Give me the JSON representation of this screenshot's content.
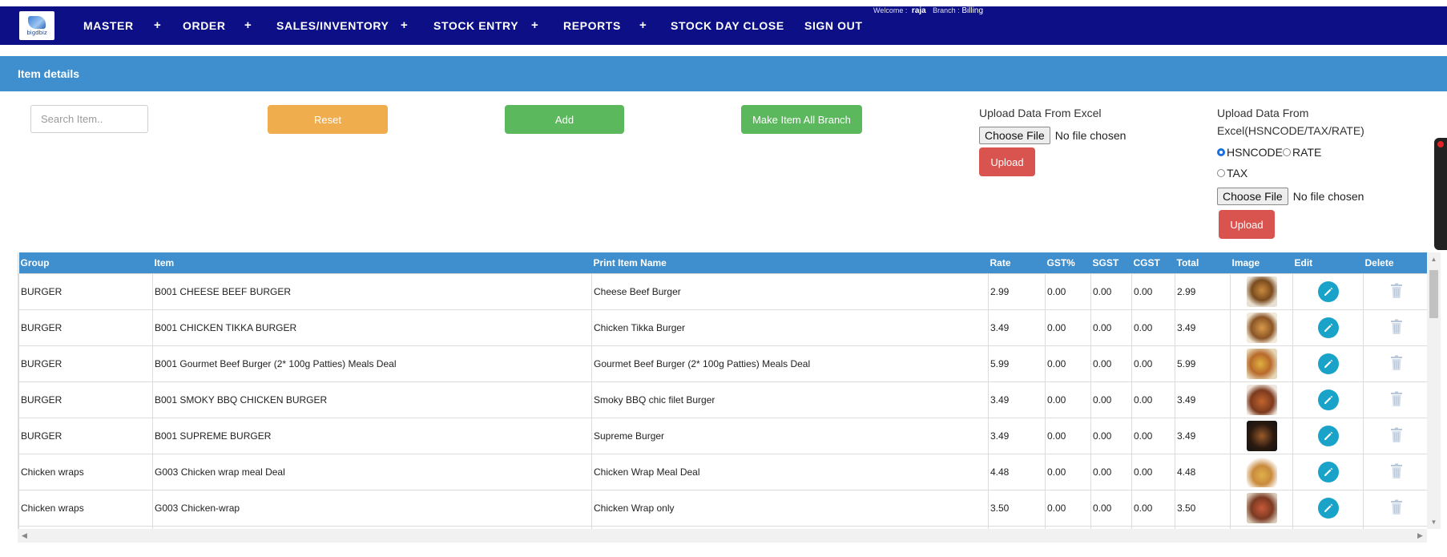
{
  "nav": {
    "logo_text": "bigdbiz",
    "items": [
      "MASTER",
      "ORDER",
      "SALES/INVENTORY",
      "STOCK ENTRY",
      "REPORTS",
      "STOCK DAY CLOSE",
      "SIGN OUT"
    ],
    "plus": "+",
    "welcome_label": "Welcome :",
    "user": "raja",
    "branch_label": "Branch :",
    "branch": "Billing"
  },
  "panel": {
    "title": "Item details"
  },
  "controls": {
    "search_placeholder": "Search Item..",
    "reset_label": "Reset",
    "add_label": "Add",
    "make_all_branch_label": "Make Item All Branch"
  },
  "upload_excel": {
    "title": "Upload Data From Excel",
    "choose_file": "Choose File",
    "no_file": "No file chosen",
    "upload_label": "Upload"
  },
  "upload_hsn": {
    "title_line1": "Upload Data From",
    "title_line2": "Excel(HSNCODE/TAX/RATE)",
    "options": [
      "HSNCODE",
      "RATE",
      "TAX"
    ],
    "selected": "HSNCODE",
    "choose_file": "Choose File",
    "no_file": "No file chosen",
    "upload_label": "Upload"
  },
  "table": {
    "headers": [
      "Group",
      "Item",
      "Print Item Name",
      "Rate",
      "GST%",
      "SGST",
      "CGST",
      "Total",
      "Image",
      "Edit",
      "Delete"
    ],
    "rows": [
      {
        "group": "BURGER",
        "item": "B001 CHEESE BEEF BURGER",
        "print_name": "Cheese Beef Burger",
        "rate": "2.99",
        "gst": "0.00",
        "sgst": "0.00",
        "cgst": "0.00",
        "total": "2.99"
      },
      {
        "group": "BURGER",
        "item": "B001 CHICKEN TIKKA BURGER",
        "print_name": "Chicken Tikka Burger",
        "rate": "3.49",
        "gst": "0.00",
        "sgst": "0.00",
        "cgst": "0.00",
        "total": "3.49"
      },
      {
        "group": "BURGER",
        "item": "B001 Gourmet Beef Burger (2* 100g Patties) Meals Deal",
        "print_name": "Gourmet Beef Burger (2* 100g Patties) Meals Deal",
        "rate": "5.99",
        "gst": "0.00",
        "sgst": "0.00",
        "cgst": "0.00",
        "total": "5.99"
      },
      {
        "group": "BURGER",
        "item": "B001 SMOKY BBQ CHICKEN BURGER",
        "print_name": "Smoky BBQ chic filet Burger",
        "rate": "3.49",
        "gst": "0.00",
        "sgst": "0.00",
        "cgst": "0.00",
        "total": "3.49"
      },
      {
        "group": "BURGER",
        "item": "B001 SUPREME BURGER",
        "print_name": "Supreme Burger",
        "rate": "3.49",
        "gst": "0.00",
        "sgst": "0.00",
        "cgst": "0.00",
        "total": "3.49"
      },
      {
        "group": "Chicken wraps",
        "item": "G003 Chicken wrap meal Deal",
        "print_name": "Chicken Wrap Meal Deal",
        "rate": "4.48",
        "gst": "0.00",
        "sgst": "0.00",
        "cgst": "0.00",
        "total": "4.48"
      },
      {
        "group": "Chicken wraps",
        "item": "G003 Chicken-wrap",
        "print_name": "Chicken Wrap only",
        "rate": "3.50",
        "gst": "0.00",
        "sgst": "0.00",
        "cgst": "0.00",
        "total": "3.50"
      },
      {
        "group": "",
        "item": "",
        "print_name": "",
        "rate": "",
        "gst": "",
        "sgst": "",
        "cgst": "",
        "total": ""
      }
    ]
  },
  "colors": {
    "nav_bg": "#0c0f85",
    "panel_header": "#3f8fce",
    "reset": "#f0ad4e",
    "add": "#5cb85c",
    "upload": "#d9534f",
    "edit": "#1aa3c9"
  }
}
